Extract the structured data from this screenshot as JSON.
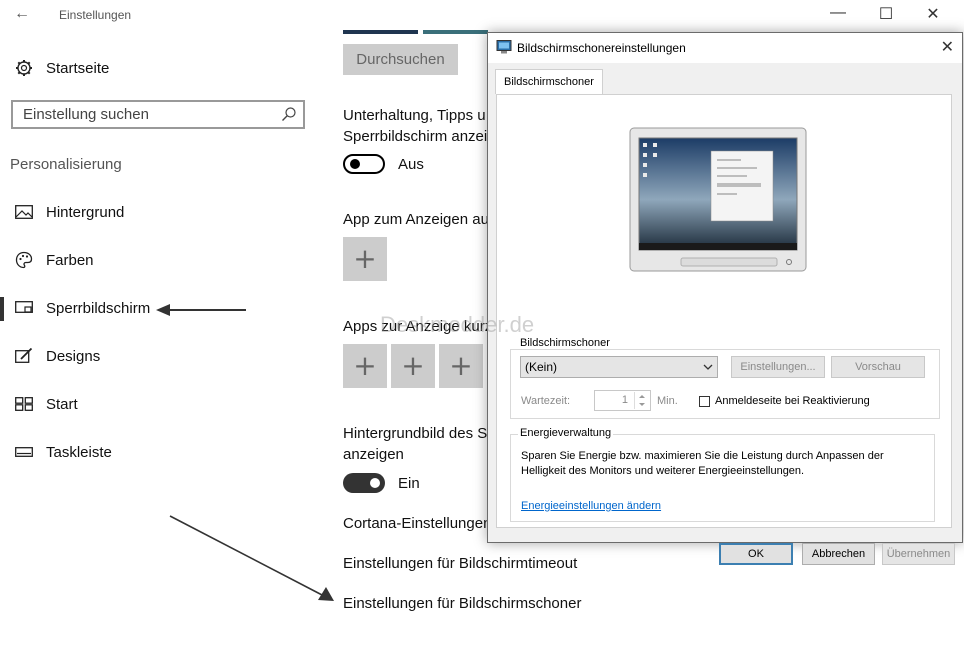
{
  "settings": {
    "title": "Einstellungen",
    "window_controls": {
      "minimize": "—",
      "maximize": "☐",
      "close": "✕"
    },
    "home_label": "Startseite",
    "search_placeholder": "Einstellung suchen",
    "section_label": "Personalisierung",
    "nav_items": [
      {
        "label": "Hintergrund",
        "icon": "picture-icon"
      },
      {
        "label": "Farben",
        "icon": "palette-icon"
      },
      {
        "label": "Sperrbildschirm",
        "icon": "lock-screen-icon",
        "selected": true
      },
      {
        "label": "Designs",
        "icon": "brush-icon"
      },
      {
        "label": "Start",
        "icon": "start-tiles-icon"
      },
      {
        "label": "Taskleiste",
        "icon": "taskbar-icon"
      }
    ],
    "content": {
      "browse_label": "Durchsuchen",
      "tips_text_line1": "Unterhaltung, Tipps u",
      "tips_text_line2": "Sperrbildschirm anzeig",
      "toggle1_label": "Aus",
      "toggle1_on": false,
      "app_detail_heading": "App zum Anzeigen au",
      "apps_quick_heading": "Apps zur Anzeige kurz",
      "background_heading_line1": "Hintergrundbild des S",
      "background_heading_line2": "anzeigen",
      "toggle2_label": "Ein",
      "toggle2_on": true,
      "plus_symbol": "+",
      "link_cortana": "Cortana-Einstellungen",
      "link_timeout": "Einstellungen für Bildschirmtimeout",
      "link_screensaver": "Einstellungen für Bildschirmschoner"
    }
  },
  "watermark": "Deskmodder.de",
  "dialog": {
    "title": "Bildschirmschonereinstellungen",
    "close": "✕",
    "tab": "Bildschirmschoner",
    "screensaver_group": "Bildschirmschoner",
    "selected_saver": "(Kein)",
    "settings_button": "Einstellungen...",
    "preview_button": "Vorschau",
    "wait_label": "Wartezeit:",
    "wait_value": "1",
    "wait_unit": "Min.",
    "resume_checkbox_label": "Anmeldeseite bei Reaktivierung",
    "resume_checked": false,
    "energy_group": "Energieverwaltung",
    "energy_text_line1": "Sparen Sie Energie bzw. maximieren Sie die Leistung durch Anpassen der",
    "energy_text_line2": "Helligkeit des Monitors und weiterer Energieeinstellungen.",
    "energy_link": "Energieeinstellungen ändern",
    "ok": "OK",
    "cancel": "Abbrechen",
    "apply": "Übernehmen"
  }
}
